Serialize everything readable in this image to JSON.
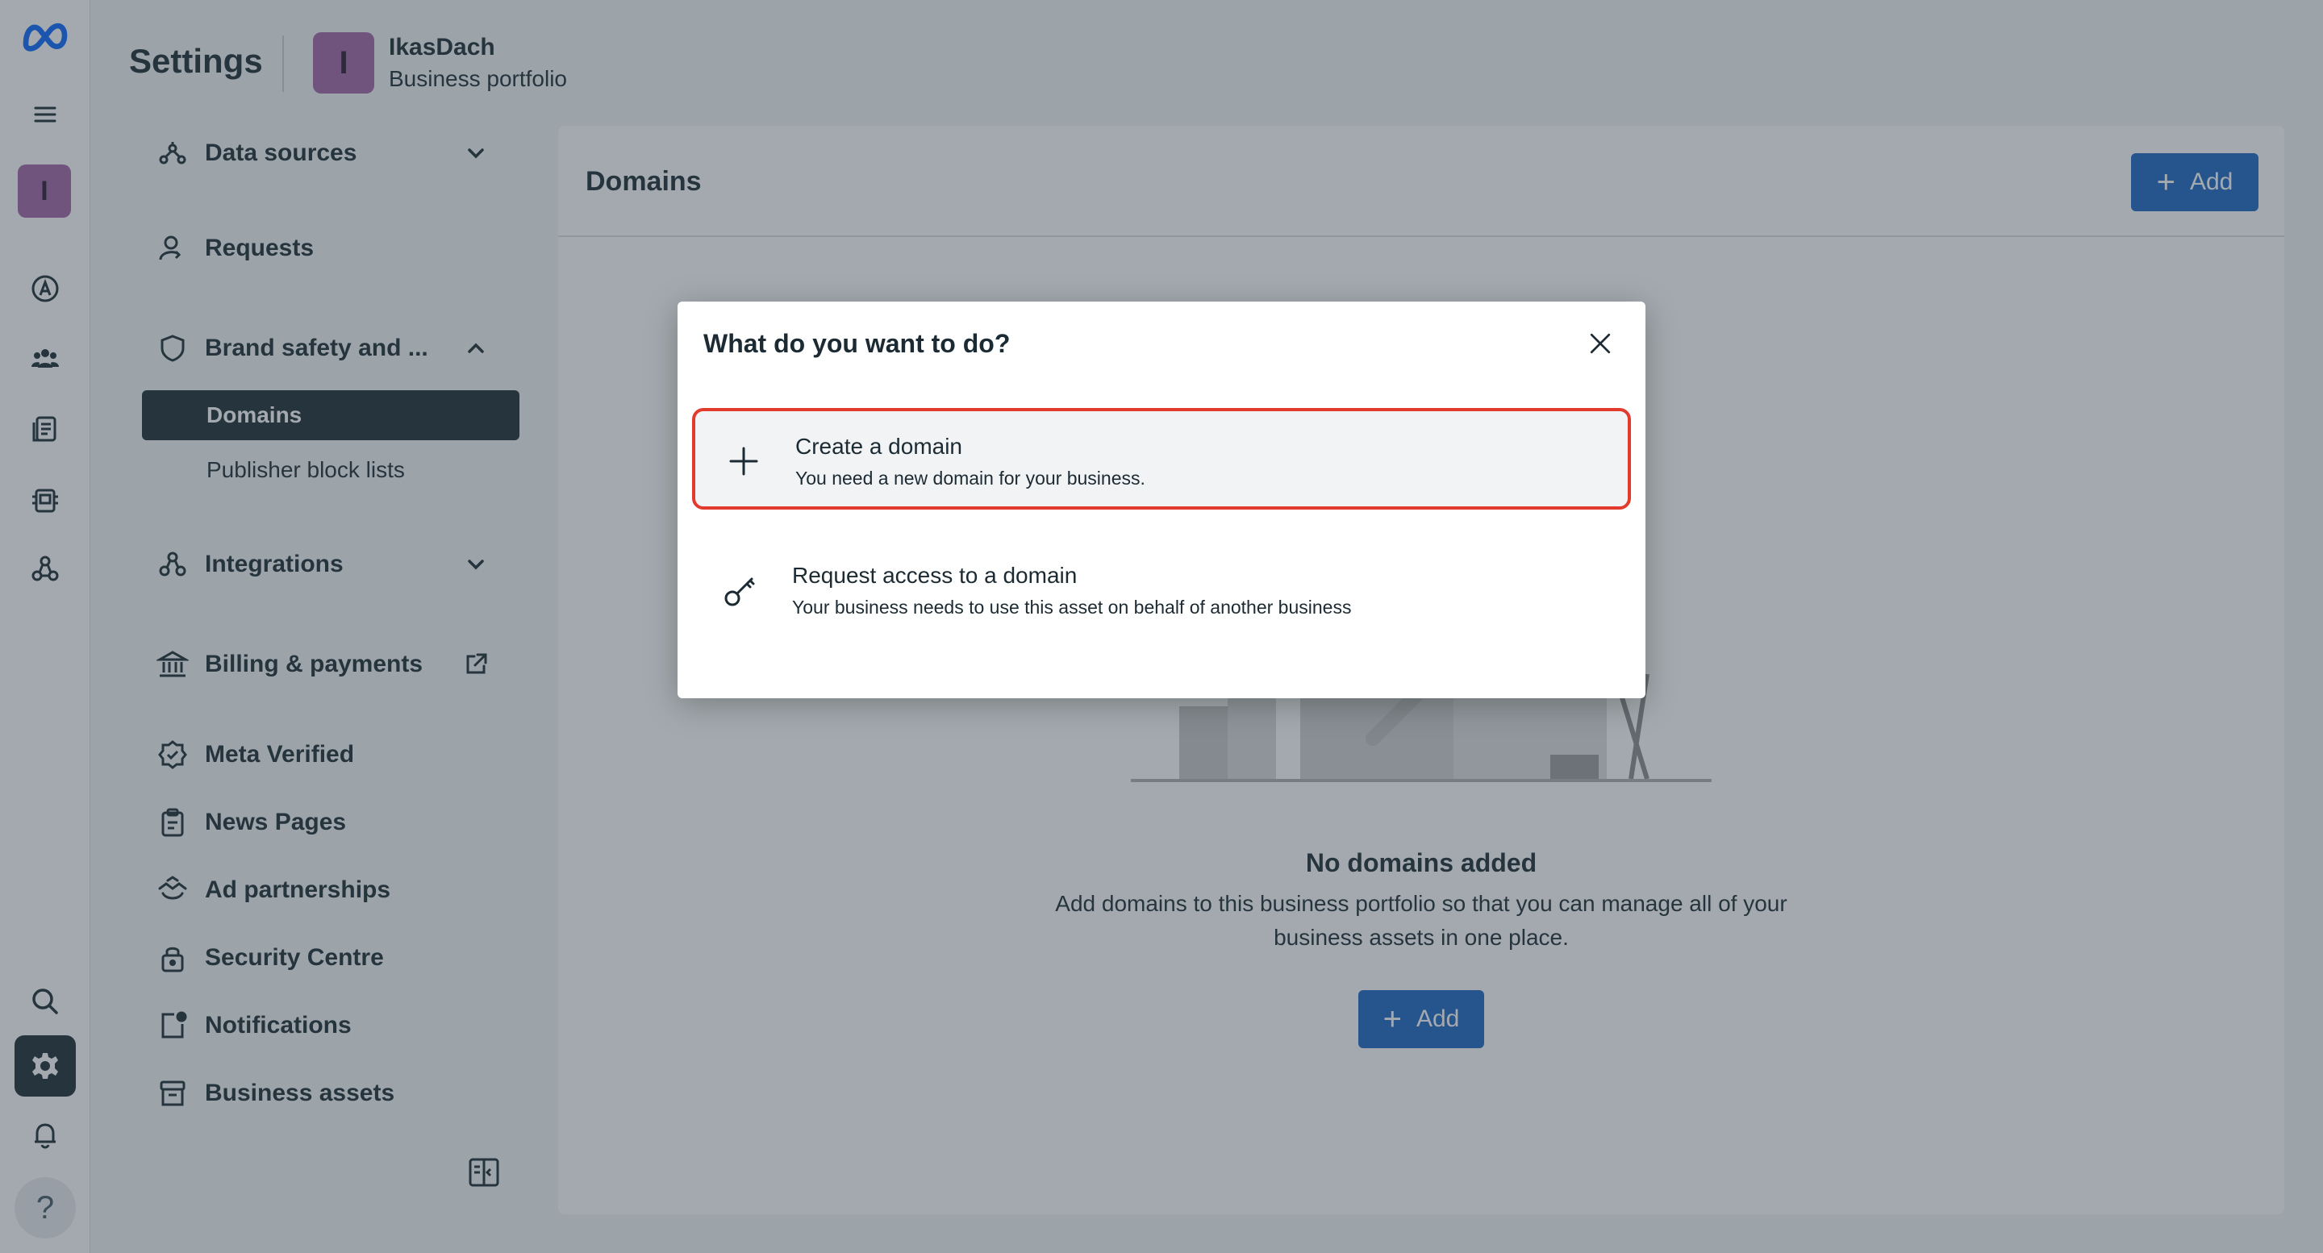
{
  "header": {
    "title": "Settings",
    "business_initial": "I",
    "business_name": "IkasDach",
    "business_subtitle": "Business portfolio"
  },
  "rail": {
    "avatar_initial": "I",
    "help_label": "?"
  },
  "nav": {
    "data_sources": "Data sources",
    "requests": "Requests",
    "brand_safety": "Brand safety and ...",
    "domains": "Domains",
    "publisher_block_lists": "Publisher block lists",
    "integrations": "Integrations",
    "billing": "Billing & payments",
    "meta_verified": "Meta Verified",
    "news_pages": "News Pages",
    "ad_partnerships": "Ad partnerships",
    "security_centre": "Security Centre",
    "notifications": "Notifications",
    "business_assets": "Business assets"
  },
  "main": {
    "title": "Domains",
    "add_label": "Add",
    "empty_title": "No domains added",
    "empty_desc": "Add domains to this business portfolio so that you can manage all of your business assets in one place.",
    "empty_add_label": "Add"
  },
  "dialog": {
    "title": "What do you want to do?",
    "options": [
      {
        "title": "Create a domain",
        "desc": "You need a new domain for your business."
      },
      {
        "title": "Request access to a domain",
        "desc": "Your business needs to use this asset on behalf of another business"
      }
    ]
  },
  "colors": {
    "accent": "#1d65c1",
    "highlight_border": "#e23b2e",
    "dark": "#1c2b33",
    "avatar": "#a564a6"
  }
}
